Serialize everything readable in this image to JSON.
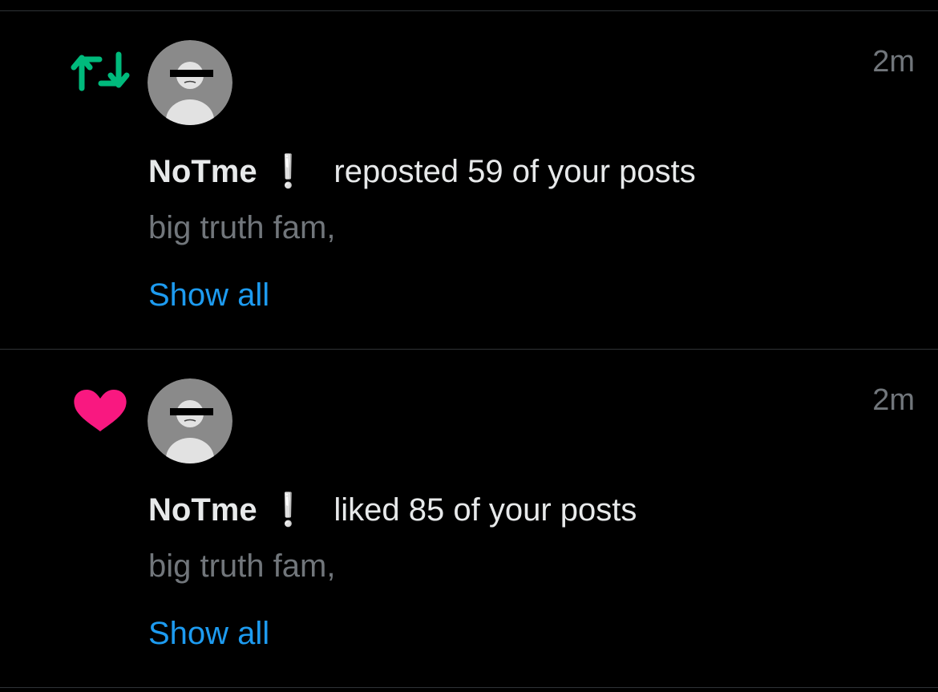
{
  "colors": {
    "background": "#000000",
    "primary_text": "#e7e9ea",
    "secondary_text": "#71767b",
    "link": "#1d9bf0",
    "repost_icon": "#00ba7c",
    "like_icon": "#f91880",
    "divider": "#2f3336"
  },
  "notifications": [
    {
      "type_icon": "repost-icon",
      "avatar_icon": "avatar-icon",
      "timestamp": "2m",
      "username": "NoTme",
      "badge": "❕",
      "action": "reposted 59 of your posts",
      "snippet": "big truth fam,",
      "show_all": "Show all"
    },
    {
      "type_icon": "heart-icon",
      "avatar_icon": "avatar-icon",
      "timestamp": "2m",
      "username": "NoTme",
      "badge": "❕",
      "action": "liked 85 of your posts",
      "snippet": "big truth fam,",
      "show_all": "Show all"
    }
  ]
}
